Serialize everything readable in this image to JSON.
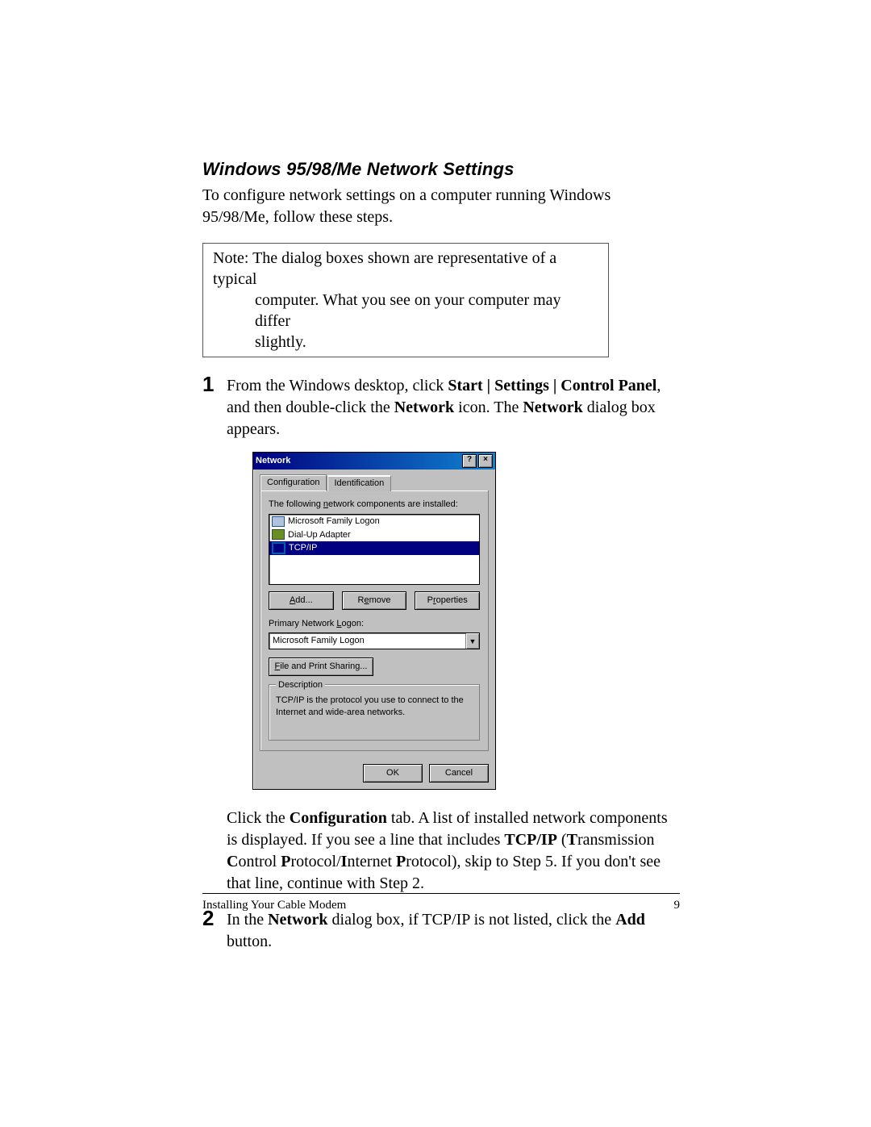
{
  "heading": "Windows 95/98/Me Network Settings",
  "intro": "To configure network settings on a computer running Windows 95/98/Me, follow these steps.",
  "note_line1": "Note: The dialog boxes shown are representative of a typical",
  "note_line2": "computer. What you see on your computer may differ",
  "note_line3": "slightly.",
  "step1": {
    "num": "1",
    "pre": "From the Windows desktop, click ",
    "b1": "Start | Settings | Control Panel",
    "mid1": ", and then double-click the ",
    "b2": "Network",
    "mid2": " icon. The ",
    "b3": "Network",
    "post": " dialog box appears."
  },
  "dlg": {
    "title": "Network",
    "help": "?",
    "close": "×",
    "tab_config": "Configuration",
    "tab_ident": "Identification",
    "installed_label": "The following network components are installed:",
    "items": {
      "0": "Microsoft Family Logon",
      "1": "Dial-Up Adapter",
      "2": "TCP/IP"
    },
    "add_btn": "Add...",
    "remove_btn": "Remove",
    "props_btn": "Properties",
    "pnl_label": "Primary Network Logon:",
    "pnl_value": "Microsoft Family Logon",
    "fp_btn": "File and Print Sharing...",
    "desc_legend": "Description",
    "desc_text": "TCP/IP is the protocol you use to connect to the Internet and wide-area networks.",
    "ok": "OK",
    "cancel": "Cancel"
  },
  "after1": {
    "a": "Click the ",
    "b": "Configuration",
    "c": " tab. A list of installed network components is displayed. If you see a line that includes ",
    "d": "TCP/IP",
    "e": " (",
    "t1": "T",
    "e1": "ransmission ",
    "c1": "C",
    "e2": "ontrol ",
    "p1": "P",
    "e3": "rotocol/",
    "i1": "I",
    "e4": "nternet ",
    "p2": "P",
    "e5": "rotocol), skip to Step 5. If you don't see that line, continue with Step 2."
  },
  "step2": {
    "num": "2",
    "a": "In the ",
    "b": "Network",
    "c": " dialog box, if TCP/IP is not listed, click the ",
    "d": "Add",
    "e": " button."
  },
  "footer_left": "Installing Your Cable Modem",
  "footer_right": "9"
}
